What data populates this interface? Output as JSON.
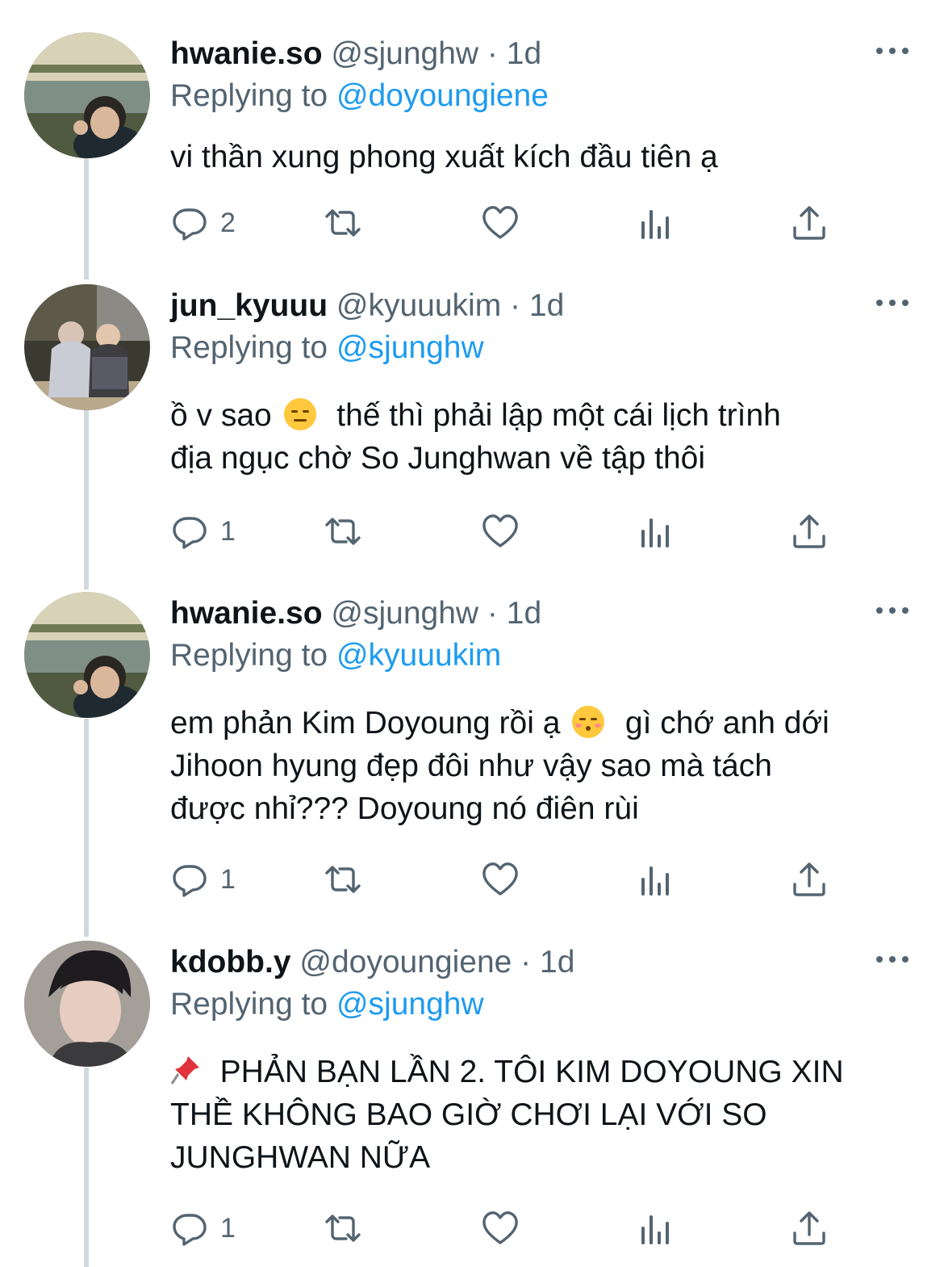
{
  "tweets": [
    {
      "name": "hwanie.so",
      "handle": "@sjunghw",
      "dot": "·",
      "time": "1d",
      "replying_label": "Replying to",
      "replying_to": "@doyoungiene",
      "text_before": "vi thần xung phong xuất kích đầu tiên ạ",
      "text_after": "",
      "reply_count": "2"
    },
    {
      "name": "jun_kyuuu",
      "handle": "@kyuuukim",
      "dot": "·",
      "time": "1d",
      "replying_label": "Replying to",
      "replying_to": "@sjunghw",
      "text_before": "ồ v sao ",
      "text_after": "  thế thì phải lập một cái lịch trình\nđịa ngục chờ So Junghwan về tập thôi",
      "reply_count": "1"
    },
    {
      "name": "hwanie.so",
      "handle": "@sjunghw",
      "dot": "·",
      "time": "1d",
      "replying_label": "Replying to",
      "replying_to": "@kyuuukim",
      "text_before": "em phản Kim Doyoung rồi ạ ",
      "text_after": "  gì chớ anh dới\nJihoon hyung đẹp đôi như vậy sao mà tách\nđược nhỉ??? Doyoung nó điên rùi",
      "reply_count": "1"
    },
    {
      "name": "kdobb.y",
      "handle": "@doyoungiene",
      "dot": "·",
      "time": "1d",
      "replying_label": "Replying to",
      "replying_to": "@sjunghw",
      "text_before": "",
      "text_after": "  PHẢN BẠN LẦN 2. TÔI KIM DOYOUNG XIN\nTHỀ KHÔNG BAO GIỜ CHƠI LẠI VỚI SO\nJUNGHWAN NỮA",
      "reply_count": "1"
    }
  ],
  "icons": {
    "reply": "reply-icon",
    "retweet": "retweet-icon",
    "like": "heart-icon",
    "views": "analytics-icon",
    "share": "share-icon",
    "more": "more-icon"
  },
  "colors": {
    "text": "#0f1419",
    "secondary": "#536471",
    "link": "#1d9bf0",
    "thread_line": "#cfd9de"
  }
}
